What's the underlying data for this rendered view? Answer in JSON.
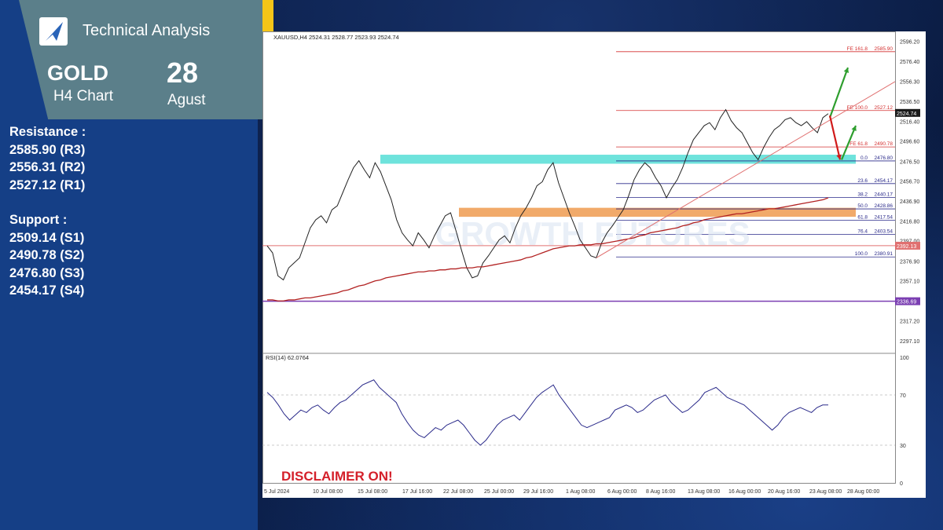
{
  "header": {
    "brand": "Technical Analysis",
    "symbol": "GOLD",
    "timeframe": "H4 Chart",
    "day": "28",
    "month": "Agust"
  },
  "levels": {
    "resistance_title": "Resistance :",
    "resistance": [
      "2585.90 (R3)",
      "2556.31 (R2)",
      "2527.12 (R1)"
    ],
    "support_title": "Support :",
    "support": [
      "2509.14 (S1)",
      "2490.78 (S2)",
      "2476.80 (S3)",
      "2454.17 (S4)"
    ]
  },
  "colors": {
    "accent_yellow": "#f5c518",
    "panel_blue": "#153f86",
    "badge_teal": "#5b7f8a",
    "zone_cyan": "#5ee0d8",
    "zone_orange": "#f0a15a",
    "ma_red": "#b22222",
    "line_purple": "#7b3fb2",
    "arrow_green": "#2e9e2e",
    "arrow_red": "#d11a1a",
    "disclaimer": "#d4202a"
  },
  "chart_data": {
    "type": "line",
    "title": "XAUUSD,H4  2524.31 2528.77 2523.93 2524.74",
    "watermark": "GROWTH FUTURES",
    "disclaimer": "DISCLAIMER ON!",
    "price_axis": {
      "ylim": [
        2287,
        2603
      ],
      "ticks": [
        "2596.20",
        "2576.40",
        "2556.30",
        "2536.50",
        "2516.40",
        "2496.60",
        "2476.50",
        "2456.70",
        "2436.90",
        "2416.80",
        "2397.00",
        "2376.90",
        "2357.10",
        "2337.30",
        "2317.20",
        "2297.10"
      ],
      "current_price": "2524.74",
      "price_tags": [
        {
          "label": "2392.13",
          "value": 2392.13,
          "color": "#e07070"
        },
        {
          "label": "2336.69",
          "value": 2336.69,
          "color": "#7b3fb2"
        }
      ]
    },
    "x_ticks": [
      "5 Jul 2024",
      "10 Jul 08:00",
      "15 Jul 08:00",
      "17 Jul 16:00",
      "22 Jul 08:00",
      "25 Jul 00:00",
      "29 Jul 16:00",
      "1 Aug 08:00",
      "6 Aug 00:00",
      "8 Aug 16:00",
      "13 Aug 08:00",
      "16 Aug 00:00",
      "20 Aug 16:00",
      "23 Aug 08:00",
      "28 Aug 00:00"
    ],
    "series": [
      {
        "name": "",
        "values": [
          2392,
          2385,
          2362,
          2358,
          2370,
          2375,
          2380,
          2395,
          2410,
          2418,
          2422,
          2415,
          2428,
          2432,
          2445,
          2458,
          2470,
          2477,
          2468,
          2460,
          2475,
          2466,
          2452,
          2438,
          2418,
          2405,
          2398,
          2392,
          2405,
          2398,
          2390,
          2402,
          2412,
          2422,
          2425,
          2407,
          2388,
          2370,
          2360,
          2362,
          2375,
          2382,
          2390,
          2398,
          2402,
          2395,
          2410,
          2422,
          2430,
          2440,
          2452,
          2456,
          2468,
          2475,
          2455,
          2440,
          2425,
          2412,
          2398,
          2390,
          2382,
          2380,
          2395,
          2405,
          2412,
          2420,
          2428,
          2442,
          2458,
          2468,
          2475,
          2470,
          2460,
          2452,
          2440,
          2450,
          2458,
          2470,
          2485,
          2498,
          2505,
          2512,
          2515,
          2508,
          2520,
          2528,
          2517,
          2510,
          2505,
          2495,
          2485,
          2478,
          2490,
          2500,
          2508,
          2512,
          2518,
          2520,
          2515,
          2512,
          2516,
          2510,
          2505,
          2520,
          2524
        ]
      },
      {
        "name": "",
        "values": [
          2338,
          2338,
          2337,
          2337,
          2338,
          2338,
          2339,
          2340,
          2340,
          2341,
          2342,
          2343,
          2344,
          2345,
          2347,
          2348,
          2350,
          2352,
          2353,
          2355,
          2357,
          2358,
          2360,
          2361,
          2362,
          2363,
          2364,
          2365,
          2366,
          2366,
          2367,
          2367,
          2368,
          2368,
          2369,
          2369,
          2370,
          2370,
          2370,
          2371,
          2371,
          2372,
          2373,
          2374,
          2375,
          2376,
          2377,
          2378,
          2380,
          2381,
          2383,
          2385,
          2387,
          2389,
          2390,
          2391,
          2392,
          2392,
          2393,
          2393,
          2393,
          2394,
          2394,
          2395,
          2396,
          2397,
          2398,
          2399,
          2400,
          2402,
          2403,
          2405,
          2406,
          2407,
          2408,
          2409,
          2410,
          2412,
          2413,
          2415,
          2416,
          2418,
          2419,
          2420,
          2421,
          2422,
          2423,
          2424,
          2424,
          2425,
          2426,
          2427,
          2428,
          2429,
          2429,
          2430,
          2431,
          2432,
          2433,
          2434,
          2435,
          2436,
          2437,
          2438,
          2440
        ]
      }
    ],
    "fib_levels": [
      {
        "label": "FE 161.8",
        "price": "2585.90",
        "value": 2585.9,
        "color": "#d43030"
      },
      {
        "label": "FE 100.0",
        "price": "2527.12",
        "value": 2527.12,
        "color": "#d43030"
      },
      {
        "label": "FE 61.8",
        "price": "2490.78",
        "value": 2490.78,
        "color": "#d43030"
      },
      {
        "label": "0.0",
        "price": "2476.80",
        "value": 2476.8,
        "color": "#2a2a8a"
      },
      {
        "label": "23.6",
        "price": "2454.17",
        "value": 2454.17,
        "color": "#2a2a8a"
      },
      {
        "label": "38.2",
        "price": "2440.17",
        "value": 2440.17,
        "color": "#2a2a8a"
      },
      {
        "label": "50.0",
        "price": "2428.86",
        "value": 2428.86,
        "color": "#2a2a8a"
      },
      {
        "label": "61.8",
        "price": "2417.54",
        "value": 2417.54,
        "color": "#2a2a8a"
      },
      {
        "label": "76.4",
        "price": "2403.54",
        "value": 2403.54,
        "color": "#2a2a8a"
      },
      {
        "label": "100.0",
        "price": "2380.91",
        "value": 2380.91,
        "color": "#2a2a8a"
      }
    ],
    "zones": [
      {
        "name": "resistance-zone",
        "from": 2474,
        "to": 2483,
        "color": "#5ee0d8"
      },
      {
        "name": "support-zone",
        "from": 2421,
        "to": 2430,
        "color": "#f0a15a"
      }
    ],
    "horizontal_lines": [
      {
        "value": 2392.13,
        "color": "#e07070"
      },
      {
        "value": 2336.69,
        "color": "#7b3fb2"
      }
    ],
    "rsi": {
      "label": "RSI(14) 62.0764",
      "ylim": [
        0,
        100
      ],
      "ticks": [
        "100",
        "70",
        "30",
        "0"
      ],
      "levels": [
        70,
        30
      ],
      "values": [
        72,
        68,
        62,
        55,
        50,
        54,
        58,
        56,
        60,
        62,
        58,
        55,
        60,
        64,
        66,
        70,
        74,
        78,
        80,
        82,
        76,
        72,
        68,
        64,
        55,
        48,
        42,
        38,
        36,
        40,
        44,
        42,
        46,
        48,
        50,
        46,
        40,
        34,
        30,
        34,
        40,
        46,
        50,
        52,
        54,
        50,
        56,
        62,
        68,
        72,
        75,
        78,
        70,
        64,
        58,
        52,
        46,
        44,
        46,
        48,
        50,
        52,
        58,
        60,
        62,
        60,
        56,
        58,
        62,
        66,
        68,
        70,
        64,
        60,
        56,
        58,
        62,
        66,
        72,
        74,
        76,
        72,
        68,
        66,
        64,
        62,
        58,
        54,
        50,
        46,
        42,
        46,
        52,
        56,
        58,
        60,
        58,
        56,
        60,
        62,
        62
      ]
    }
  }
}
